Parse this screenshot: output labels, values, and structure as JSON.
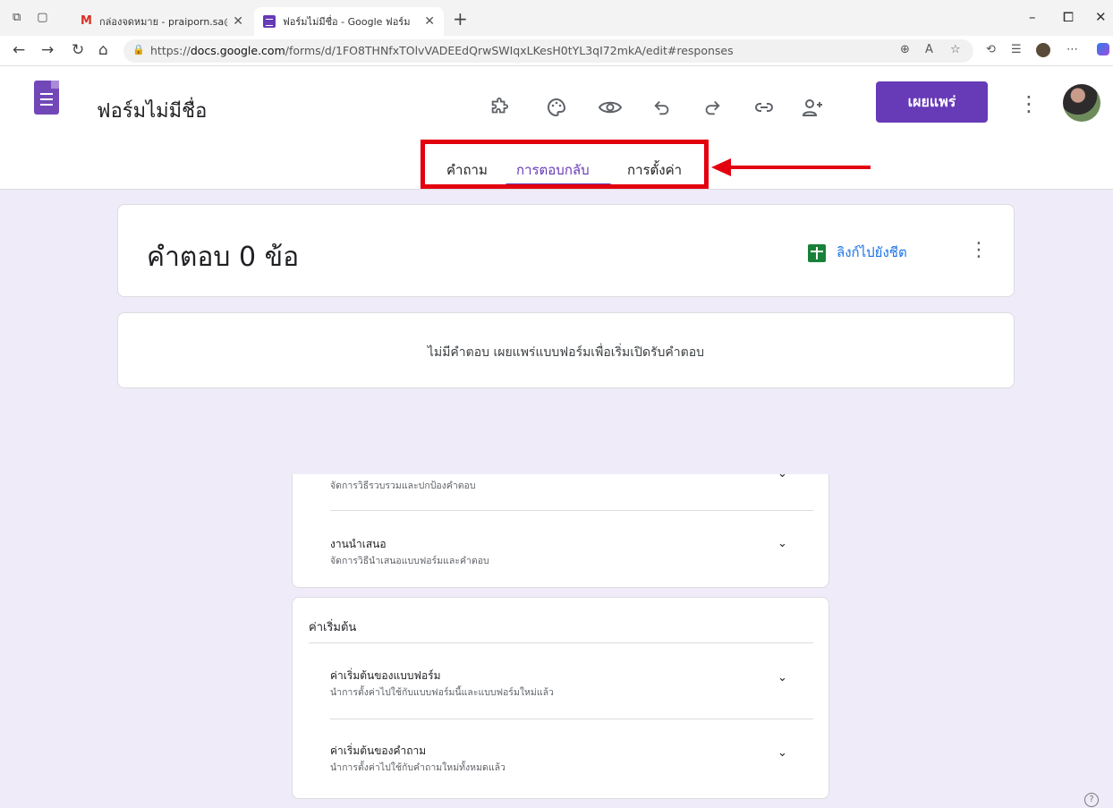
{
  "browser": {
    "tabs": [
      {
        "label": "กล่องจดหมาย - praiporn.sa@ssru.a",
        "icon": "gmail-icon"
      },
      {
        "label": "ฟอร์มไม่มีชื่อ - Google ฟอร์ม",
        "icon": "forms-icon"
      }
    ],
    "url_prefix": "https://",
    "url_domain": "docs.google.com",
    "url_path": "/forms/d/1FO8THNfxTOlvVADEEdQrwSWIqxLKesH0tYL3qI72mkA/edit#responses"
  },
  "form": {
    "title": "ฟอร์มไม่มีชื่อ",
    "publish_label": "เผยแพร่",
    "tabs": {
      "questions": "คำถาม",
      "responses": "การตอบกลับ",
      "settings": "การตั้งค่า"
    },
    "active_tab": "responses"
  },
  "responses": {
    "count_label": "คำตอบ 0 ข้อ",
    "link_sheet_label": "ลิงก์ไปยังชีต",
    "empty_message": "ไม่มีคำตอบ เผยแพร่แบบฟอร์มเพื่อเริ่มเปิดรับคำตอบ"
  },
  "settings": {
    "partial_row_sub": "จัดการวิธีรวบรวมและปกป้องคำตอบ",
    "presentation": {
      "title": "งานนำเสนอ",
      "sub": "จัดการวิธีนำเสนอแบบฟอร์มและคำตอบ"
    },
    "defaults_title": "ค่าเริ่มต้น",
    "form_defaults": {
      "title": "ค่าเริ่มต้นของแบบฟอร์ม",
      "sub": "นำการตั้งค่าไปใช้กับแบบฟอร์มนี้และแบบฟอร์มใหม่แล้ว"
    },
    "question_defaults": {
      "title": "ค่าเริ่มต้นของคำถาม",
      "sub": "นำการตั้งค่าไปใช้กับคำถามใหม่ทั้งหมดแล้ว"
    }
  },
  "colors": {
    "accent": "#673ab7",
    "annotation": "#e3000f",
    "background": "#f0ebf8"
  }
}
